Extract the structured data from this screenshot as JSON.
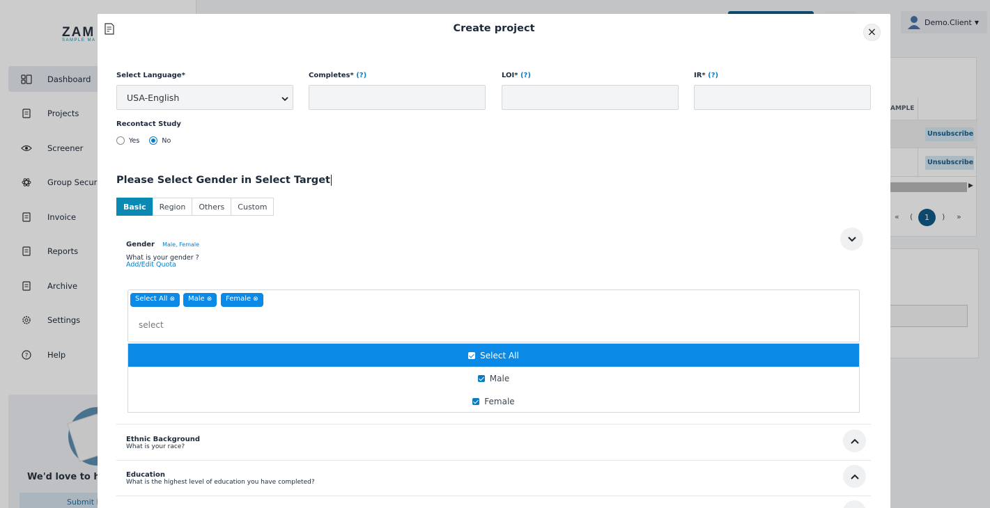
{
  "app": {
    "logo_text": "ZAM",
    "logo_sub": "SAMPLE MA",
    "user_name": "Demo.Client",
    "nav": [
      {
        "label": "Dashboard",
        "icon": "dashboard-icon"
      },
      {
        "label": "Projects",
        "icon": "document-icon"
      },
      {
        "label": "Screener",
        "icon": "eye-icon"
      },
      {
        "label": "Group Security",
        "icon": "atom-icon"
      },
      {
        "label": "Invoice",
        "icon": "document-icon"
      },
      {
        "label": "Reports",
        "icon": "document-icon"
      },
      {
        "label": "Archive",
        "icon": "document-icon"
      },
      {
        "label": "Settings",
        "icon": "gear-icon"
      },
      {
        "label": "Help",
        "icon": "help-icon"
      }
    ],
    "promo_title": "We'd love to hea",
    "promo_button": "Submit F",
    "table_header": "AMPLE",
    "unsubscribe_label": "Unsubscribe",
    "pager": {
      "first": "«",
      "prev": "(",
      "current": "1",
      "next": ")",
      "last": "»"
    }
  },
  "modal": {
    "title": "Create project",
    "close_label": "×",
    "fields": {
      "language": {
        "label": "Select Language*",
        "value": "USA-English"
      },
      "completes": {
        "label": "Completes*",
        "help": "(?)",
        "value": ""
      },
      "loi": {
        "label": "LOI*",
        "help": "(?)",
        "value": ""
      },
      "ir": {
        "label": "IR*",
        "help": "(?)",
        "value": ""
      }
    },
    "recontact": {
      "label": "Recontact Study",
      "options": [
        {
          "label": "Yes",
          "checked": false
        },
        {
          "label": "No",
          "checked": true
        }
      ]
    },
    "target_heading": "Please Select Gender in Select Target",
    "tabs": [
      "Basic",
      "Region",
      "Others",
      "Custom"
    ],
    "active_tab": "Basic",
    "gender": {
      "title": "Gender",
      "tags": "Male, Female",
      "question": "What is your gender ?",
      "quota_link": "Add/Edit Quota",
      "chips": [
        "Select All",
        "Male",
        "Female"
      ],
      "chip_remove": "⊗",
      "placeholder": "select",
      "options": [
        {
          "label": "Select All",
          "checked": true,
          "highlighted": true
        },
        {
          "label": "Male",
          "checked": true,
          "highlighted": false
        },
        {
          "label": "Female",
          "checked": true,
          "highlighted": false
        }
      ]
    },
    "accordion": [
      {
        "title": "Ethnic Background",
        "question": "What is your race?"
      },
      {
        "title": "Education",
        "question": "What is the highest level of education you have completed?"
      }
    ]
  },
  "colors": {
    "accent": "#0a89b3",
    "chip": "#0a89e6",
    "link": "#0a7cc4"
  }
}
